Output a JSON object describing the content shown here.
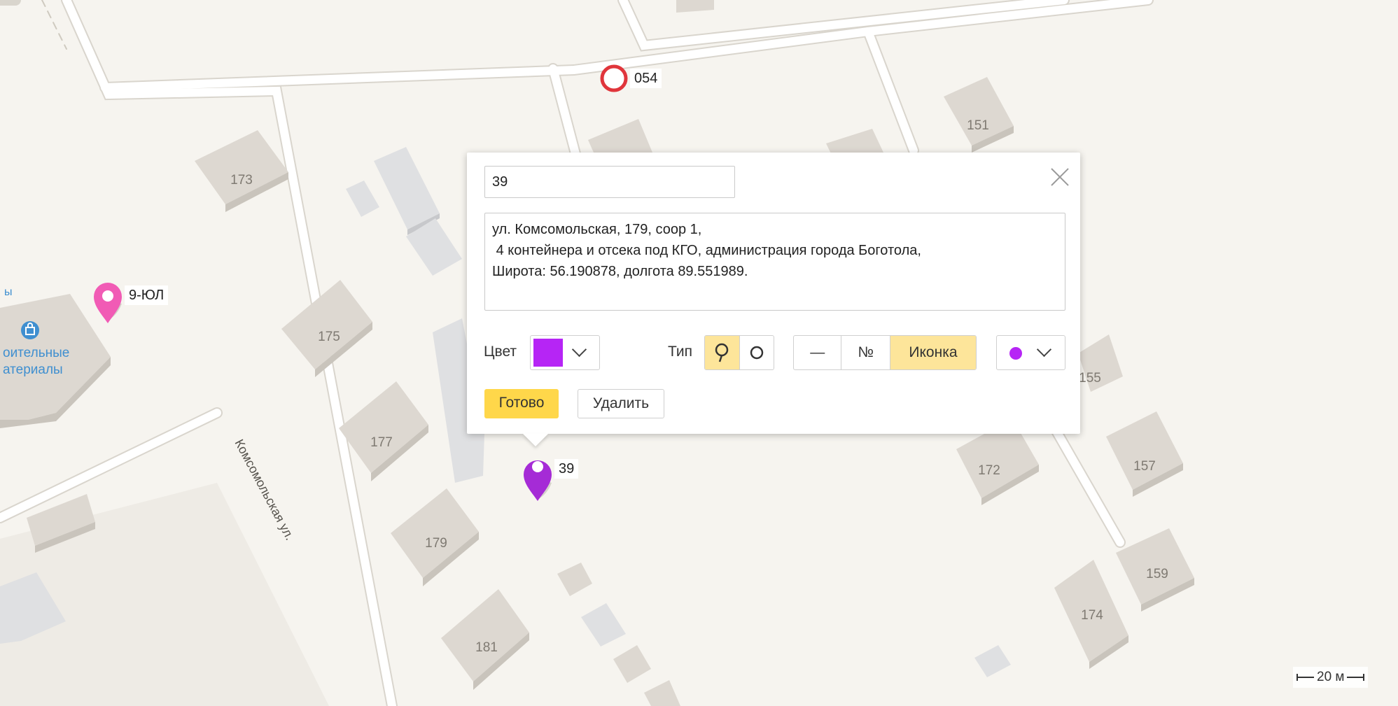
{
  "map": {
    "building_numbers": [
      "173",
      "175",
      "177",
      "179",
      "181",
      "151",
      "155",
      "157",
      "159",
      "172",
      "174"
    ],
    "street_name": "Комсомольская ул.",
    "poi": {
      "line1": "оительные",
      "line2": "атериалы",
      "icon": "shopping-bag-icon"
    },
    "markers": [
      {
        "label": "054",
        "type": "circle",
        "color": "#e0353b"
      },
      {
        "label": "9-ЮЛ",
        "type": "pin",
        "color": "#f15bb5"
      },
      {
        "label": "39",
        "type": "pin",
        "color": "#a52bd6"
      }
    ],
    "scale": {
      "label": "20 м"
    }
  },
  "editor": {
    "name_value": "39",
    "description_value": "ул. Комсомольская, 179, соор 1,\n 4 контейнера и отсека под КГО, администрация города Боготола,\nШирота: 56.190878, долгота 89.551989.",
    "color_label": "Цвет",
    "selected_color": "#b625f5",
    "type_label": "Тип",
    "type_options": [
      {
        "icon": "pin-icon",
        "active": true
      },
      {
        "icon": "circle-icon",
        "active": false
      }
    ],
    "caption_options": [
      {
        "label": "—",
        "active": false
      },
      {
        "label": "№",
        "active": false
      },
      {
        "label": "Иконка",
        "active": true
      }
    ],
    "icon_select_color": "#b625f5",
    "done_label": "Готово",
    "delete_label": "Удалить",
    "close_icon": "close-icon"
  }
}
